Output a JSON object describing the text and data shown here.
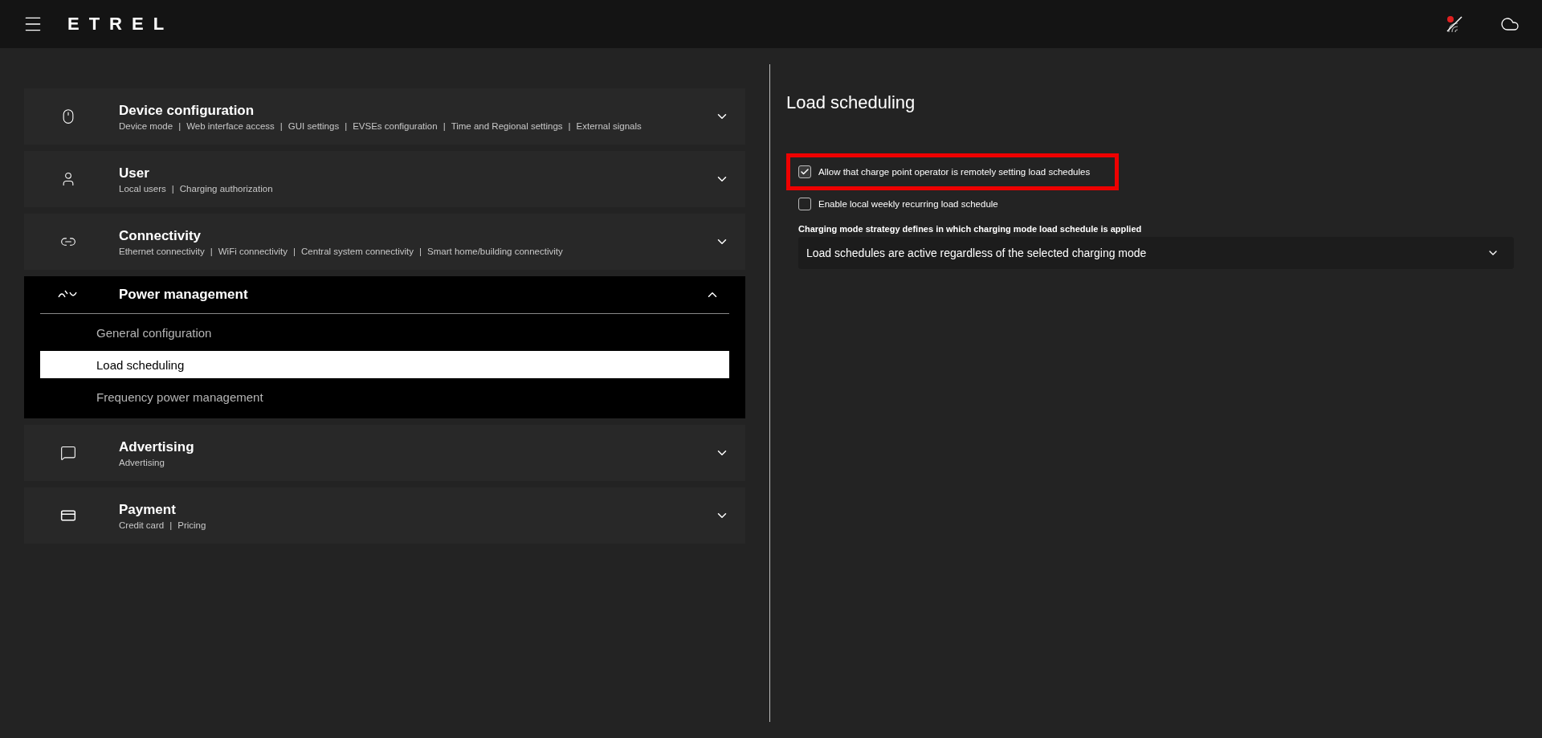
{
  "header": {
    "logo": "ETREL"
  },
  "sections": [
    {
      "kind": "device",
      "title": "Device configuration",
      "separator": "|",
      "links": [
        "Device mode",
        "Web interface access",
        "GUI settings",
        "EVSEs configuration",
        "Time and Regional settings",
        "External signals"
      ],
      "expanded": false
    },
    {
      "kind": "user",
      "title": "User",
      "separator": "|",
      "links": [
        "Local users",
        "Charging authorization"
      ],
      "expanded": false
    },
    {
      "kind": "link",
      "title": "Connectivity",
      "separator": "|",
      "links": [
        "Ethernet connectivity",
        "WiFi connectivity",
        "Central system connectivity",
        "Smart home/building connectivity"
      ],
      "expanded": false
    },
    {
      "kind": "wave",
      "title": "Power management",
      "expanded": true,
      "children": [
        {
          "label": "General configuration",
          "selected": false
        },
        {
          "label": "Load scheduling",
          "selected": true
        },
        {
          "label": "Frequency power management",
          "selected": false
        }
      ]
    },
    {
      "kind": "chat",
      "title": "Advertising",
      "links": [
        "Advertising"
      ],
      "expanded": false
    },
    {
      "kind": "cards",
      "title": "Payment",
      "separator": "|",
      "links": [
        "Credit card",
        "Pricing"
      ],
      "expanded": false
    }
  ],
  "panel": {
    "title": "Load scheduling",
    "options": [
      {
        "label": "Allow that charge point operator is remotely setting load schedules",
        "checked": true,
        "highlighted": true
      },
      {
        "label": "Enable local weekly recurring load schedule",
        "checked": false,
        "highlighted": false
      }
    ],
    "strategy_label": "Charging mode strategy defines in which charging mode load schedule is applied",
    "strategy_value": "Load schedules are active regardless of the selected charging mode"
  }
}
